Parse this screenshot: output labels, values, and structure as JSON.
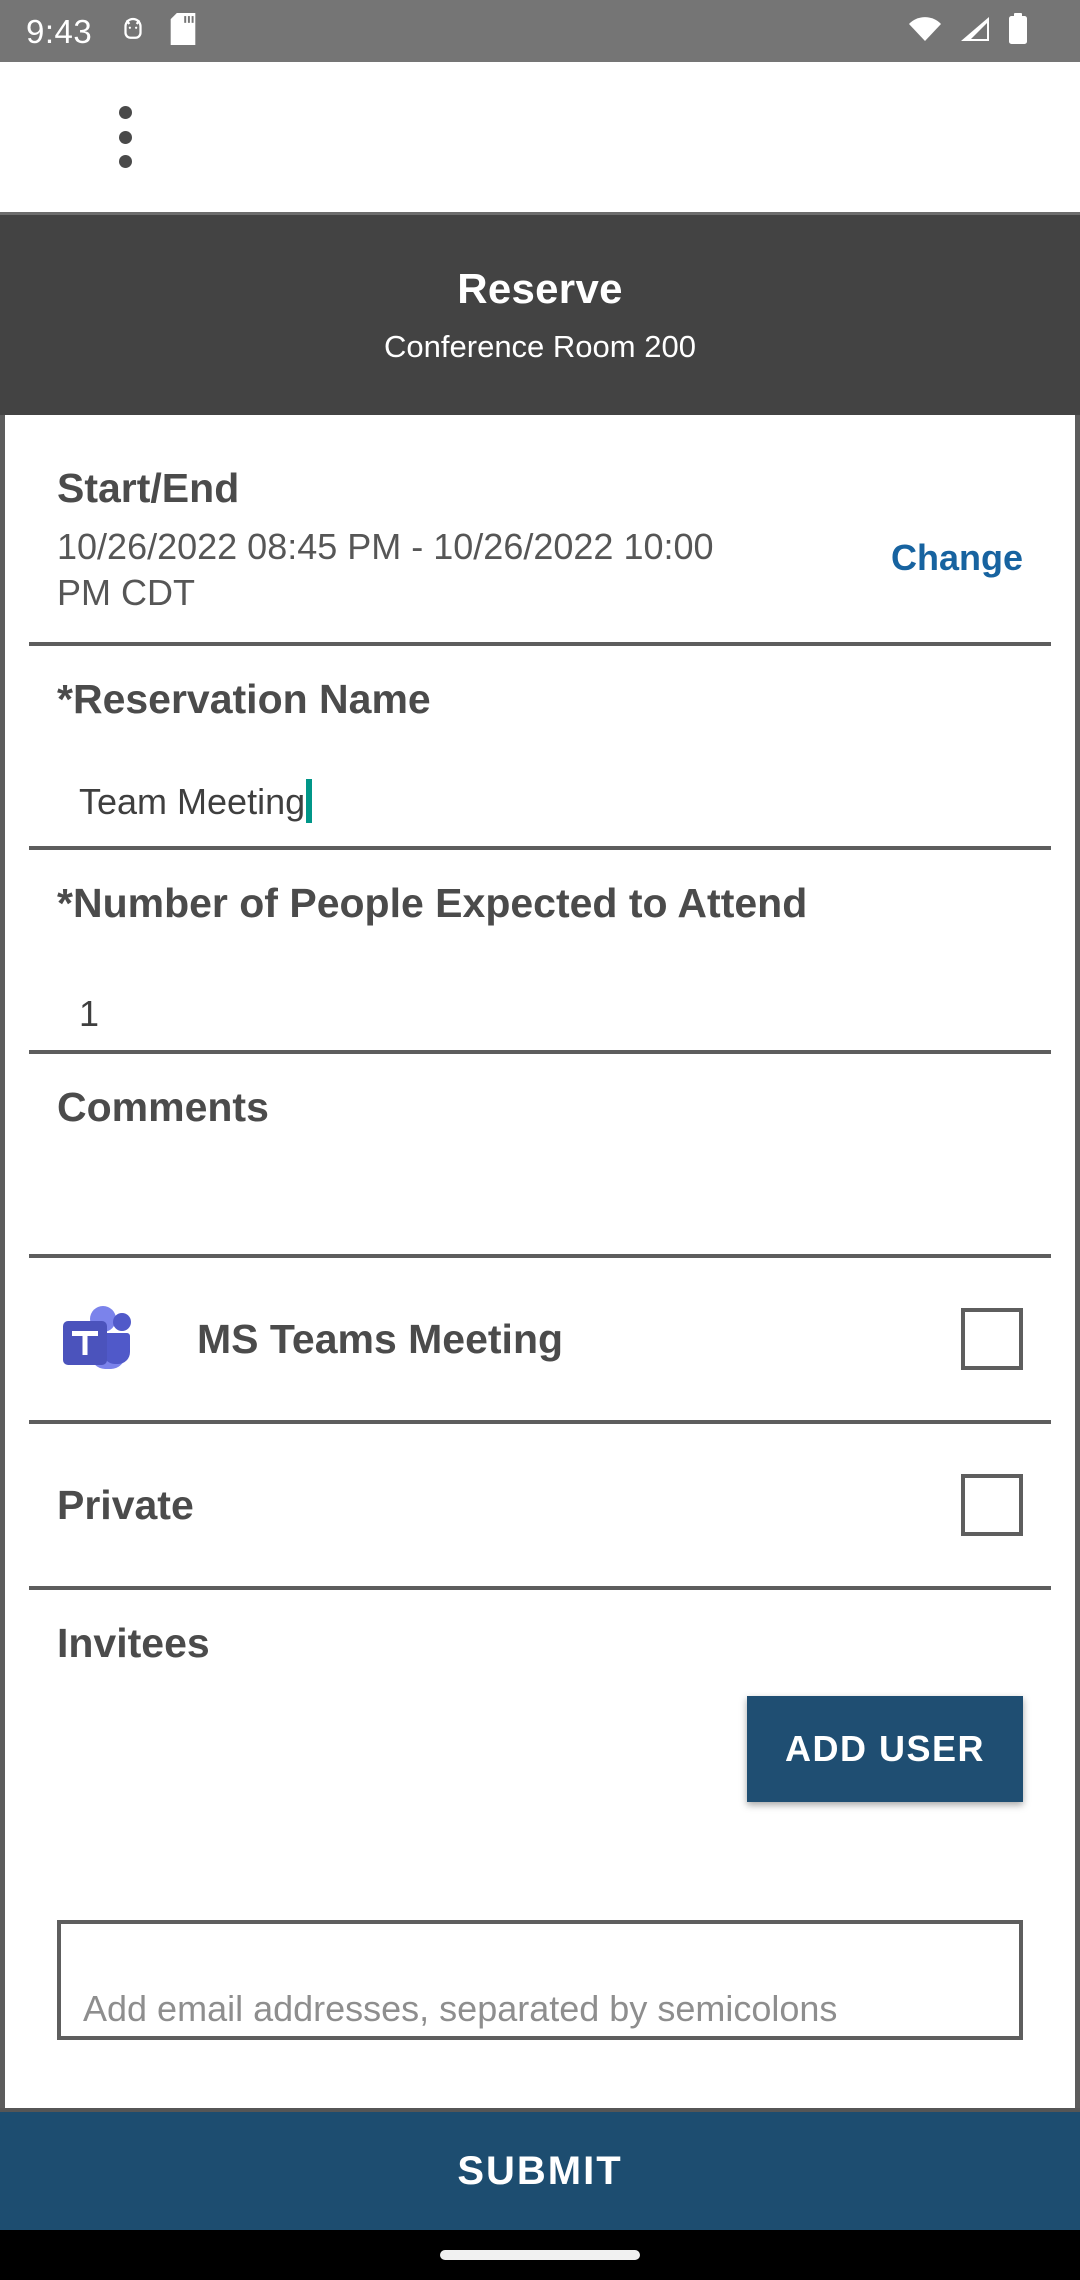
{
  "status_bar": {
    "time": "9:43",
    "left_icons": [
      "android-bug-icon",
      "sd-card-icon"
    ],
    "right_icons": [
      "wifi-icon",
      "cellular-signal-icon",
      "battery-icon"
    ],
    "background_color": "#757575"
  },
  "app_bar": {
    "overflow_menu_icon": "more-vertical-icon"
  },
  "header": {
    "title": "Reserve",
    "subtitle": "Conference Room 200",
    "background_color": "#434343"
  },
  "form": {
    "start_end": {
      "label": "Start/End",
      "value": "10/26/2022 08:45 PM - 10/26/2022 10:00 PM CDT",
      "change_label": "Change",
      "change_color": "#1763a0"
    },
    "reservation_name": {
      "label": "*Reservation Name",
      "value": "Team Meeting",
      "caret_color": "#009688"
    },
    "attendee_count": {
      "label": "*Number of People Expected to Attend",
      "value": "1"
    },
    "comments": {
      "label": "Comments",
      "value": ""
    },
    "teams_meeting": {
      "label": "MS Teams Meeting",
      "icon": "ms-teams-logo-icon",
      "checked": false
    },
    "private": {
      "label": "Private",
      "checked": false
    },
    "invitees": {
      "label": "Invitees",
      "add_user_label": "ADD USER",
      "add_user_color": "#1f4e72",
      "email_placeholder": "Add email addresses, separated by semicolons"
    }
  },
  "submit": {
    "label": "SUBMIT",
    "color": "#1d4d70"
  }
}
